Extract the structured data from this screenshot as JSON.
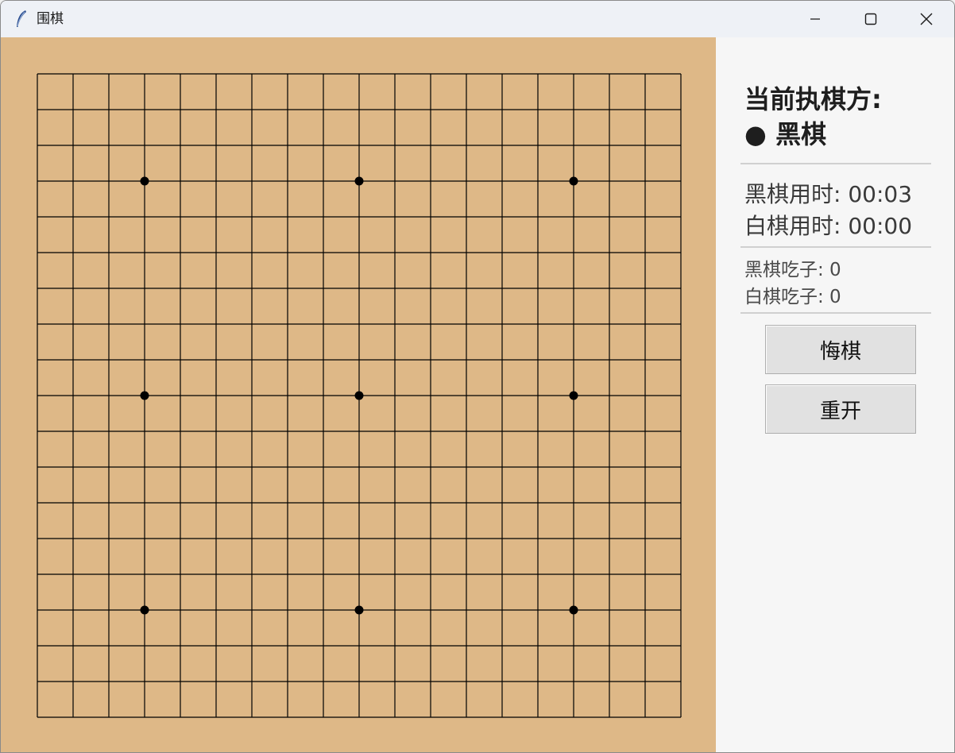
{
  "window": {
    "title": "围棋",
    "icon": "feather-icon",
    "controls": [
      "minimize-icon",
      "maximize-icon",
      "close-icon"
    ]
  },
  "board": {
    "lines": 19,
    "background_color": "#deb887",
    "line_color": "#000000",
    "star_points": [
      [
        3,
        3
      ],
      [
        9,
        3
      ],
      [
        15,
        3
      ],
      [
        3,
        9
      ],
      [
        9,
        9
      ],
      [
        15,
        9
      ],
      [
        3,
        15
      ],
      [
        9,
        15
      ],
      [
        15,
        15
      ]
    ],
    "stones": []
  },
  "panel": {
    "turn_title": "当前执棋方:",
    "turn_value": "● 黑棋",
    "black_time": "黑棋用时: 00:03",
    "white_time": "白棋用时: 00:00",
    "black_captures": "黑棋吃子: 0",
    "white_captures": "白棋吃子: 0",
    "undo_label": "悔棋",
    "restart_label": "重开"
  }
}
